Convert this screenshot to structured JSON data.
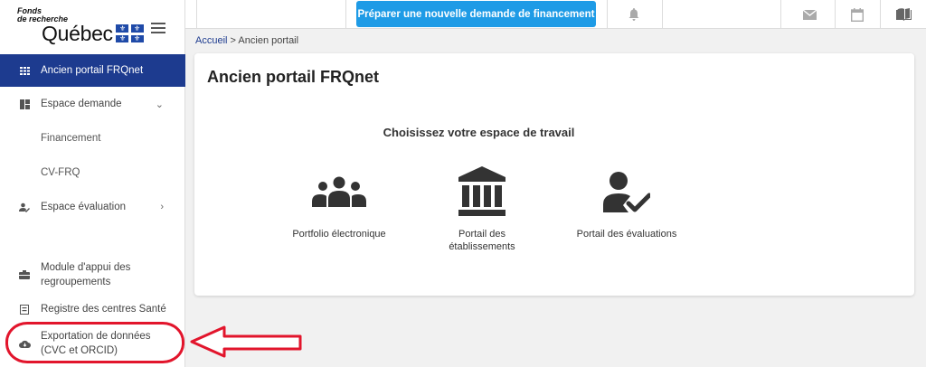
{
  "logo": {
    "line1": "Fonds",
    "line2": "de recherche",
    "name": "Québec",
    "flag_color": "#1f4aa8"
  },
  "sidebar": {
    "items": [
      {
        "label": "Ancien portail FRQnet",
        "icon": "grid-icon",
        "active": true
      },
      {
        "label": "Espace demande",
        "icon": "dashboard-icon",
        "chevron": "down"
      },
      {
        "label": "Financement",
        "sub": true
      },
      {
        "label": "CV-FRQ",
        "sub": true
      },
      {
        "label": "Espace évaluation",
        "icon": "evaluation-icon",
        "chevron": "right"
      },
      {
        "label": "Module d'appui des regroupements",
        "icon": "toolbox-icon"
      },
      {
        "label": "Registre des centres Santé",
        "icon": "registry-icon"
      },
      {
        "label": "Exportation de données (CVC et ORCID)",
        "icon": "cloud-download-icon",
        "highlighted": true
      }
    ],
    "accent_color": "#1d3b8f"
  },
  "topbar": {
    "cta_label": "Préparer une nouvelle demande de financement",
    "cta_color": "#1e9be6",
    "icons": [
      "bell-icon",
      "mail-icon",
      "calendar-icon",
      "book-icon"
    ]
  },
  "breadcrumb": {
    "home": "Accueil",
    "separator": ">",
    "current": "Ancien portail"
  },
  "main": {
    "title": "Ancien portail FRQnet",
    "subtitle": "Choisissez votre espace de travail",
    "portals": [
      {
        "label": "Portfolio électronique",
        "icon": "group-icon"
      },
      {
        "label": "Portail des établissements",
        "icon": "institution-icon"
      },
      {
        "label": "Portail des évaluations",
        "icon": "user-check-icon"
      }
    ]
  },
  "annotation": {
    "color": "#e2152c"
  }
}
